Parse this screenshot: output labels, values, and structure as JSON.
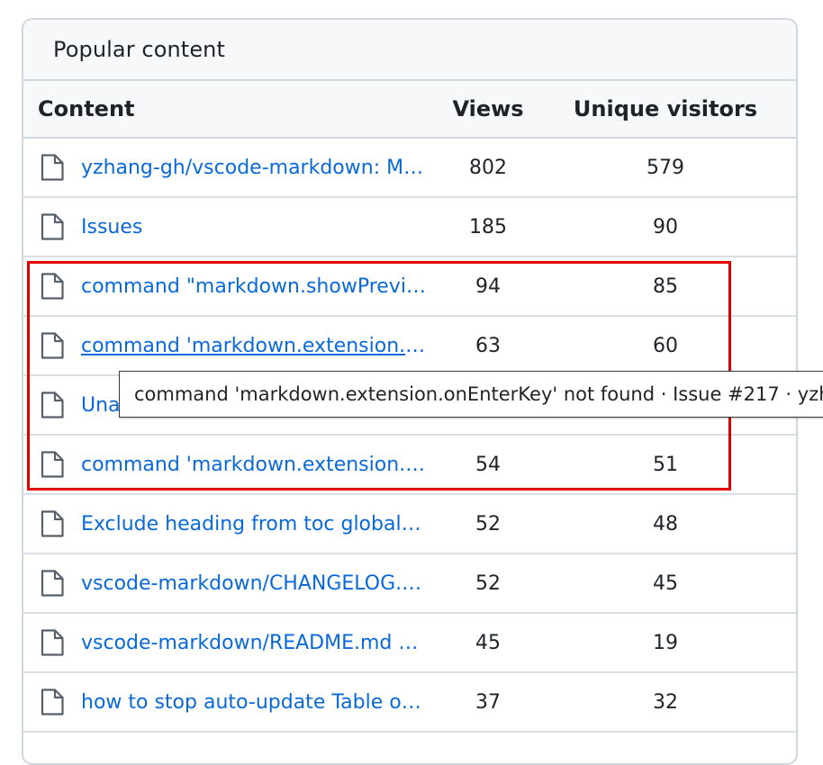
{
  "panel": {
    "title": "Popular content"
  },
  "table": {
    "headers": {
      "content": "Content",
      "views": "Views",
      "unique": "Unique visitors"
    },
    "rows": [
      {
        "title": "yzhang-gh/vscode-markdown: Ma…",
        "views": "802",
        "unique": "579",
        "icon": "file-icon"
      },
      {
        "title": "Issues",
        "views": "185",
        "unique": "90",
        "icon": "file-icon"
      },
      {
        "title": "command \"markdown.showPrevie…",
        "views": "94",
        "unique": "85",
        "icon": "file-icon"
      },
      {
        "title": "command 'markdown.extension.o…",
        "views": "63",
        "unique": "60",
        "icon": "file-icon",
        "hovered": true
      },
      {
        "title": "Una",
        "views": "",
        "unique": "",
        "icon": "file-icon"
      },
      {
        "title": "command 'markdown.extension.o…",
        "views": "54",
        "unique": "51",
        "icon": "file-icon"
      },
      {
        "title": "Exclude heading from toc globally …",
        "views": "52",
        "unique": "48",
        "icon": "file-icon"
      },
      {
        "title": "vscode-markdown/CHANGELOG.…",
        "views": "52",
        "unique": "45",
        "icon": "file-icon"
      },
      {
        "title": "vscode-markdown/README.md at…",
        "views": "45",
        "unique": "19",
        "icon": "file-icon"
      },
      {
        "title": "how to stop auto-update Table of …",
        "views": "37",
        "unique": "32",
        "icon": "file-icon"
      }
    ]
  },
  "tooltip": {
    "text": "command 'markdown.extension.onEnterKey' not found · Issue #217 · yzh"
  },
  "colors": {
    "link": "#0969da",
    "highlight": "#e00000",
    "border": "#d0d7de",
    "header_bg": "#f6f8fa"
  }
}
